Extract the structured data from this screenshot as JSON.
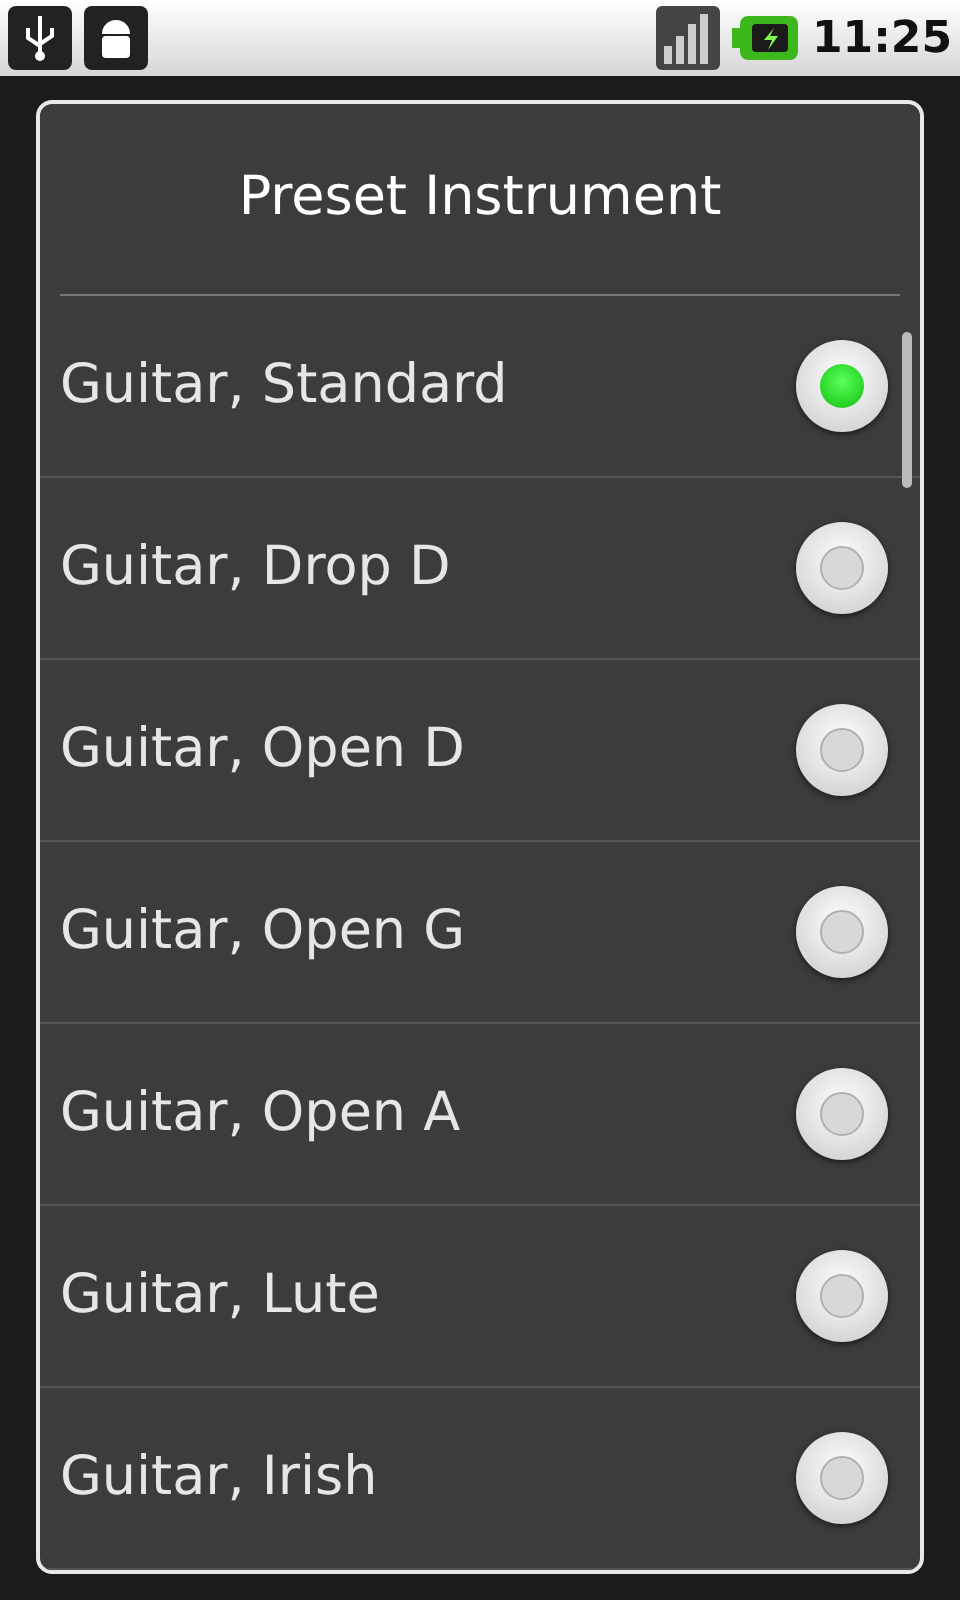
{
  "status_bar": {
    "time": "11:25"
  },
  "dialog": {
    "title": "Preset Instrument",
    "options": [
      {
        "label": "Guitar, Standard",
        "selected": true
      },
      {
        "label": "Guitar, Drop D",
        "selected": false
      },
      {
        "label": "Guitar, Open D",
        "selected": false
      },
      {
        "label": "Guitar, Open G",
        "selected": false
      },
      {
        "label": "Guitar, Open A",
        "selected": false
      },
      {
        "label": "Guitar, Lute",
        "selected": false
      },
      {
        "label": "Guitar, Irish",
        "selected": false
      }
    ]
  }
}
